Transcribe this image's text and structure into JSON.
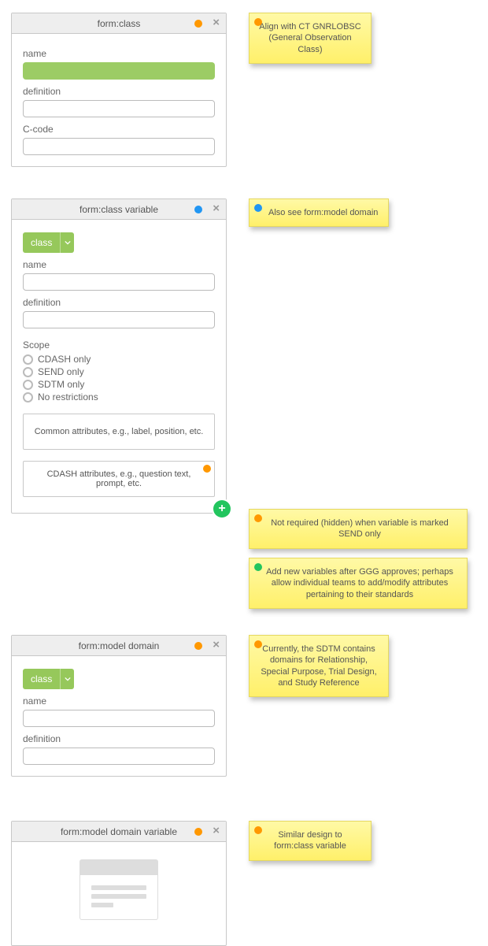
{
  "panels": {
    "class": {
      "title": "form:class",
      "fields": {
        "name": "name",
        "definition": "definition",
        "ccode": "C-code"
      }
    },
    "classVar": {
      "title": "form:class variable",
      "select": "class",
      "fields": {
        "name": "name",
        "definition": "definition",
        "scope": "Scope"
      },
      "scopeOptions": [
        "CDASH only",
        "SEND only",
        "SDTM only",
        "No restrictions"
      ],
      "boxCommon": "Common attributes, e.g., label, position, etc.",
      "boxCdash": "CDASH attributes, e.g., question text, prompt, etc."
    },
    "modelDomain": {
      "title": "form:model domain",
      "select": "class",
      "fields": {
        "name": "name",
        "definition": "definition"
      }
    },
    "modelDomainVar": {
      "title": "form:model domain variable"
    }
  },
  "notes": {
    "n1": "Align with CT GNRLOBSC (General Observation Class)",
    "n2": "Also see form:model domain",
    "n3": "Not required (hidden) when variable is marked SEND only",
    "n4": "Add new variables after GGG approves; perhaps allow individual teams to add/modify attributes pertaining to their standards",
    "n5": "Currently, the SDTM contains domains for Relationship, Special Purpose, Trial Design, and Study Reference",
    "n6": "Similar design to form:class variable"
  }
}
